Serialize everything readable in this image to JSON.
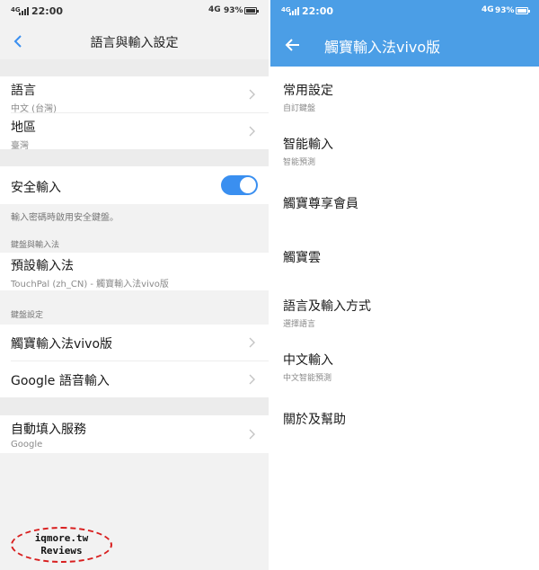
{
  "status_left": {
    "network": "4G",
    "time": "22:00",
    "network2": "4G",
    "battery": "93%",
    "battery_level": 0.93
  },
  "status_right": {
    "network": "4G",
    "time": "22:00",
    "network2": "4G",
    "battery": "93%",
    "battery_level": 0.93
  },
  "left": {
    "title": "語言與輸入設定",
    "language": {
      "label": "語言",
      "value": "中文 (台灣)"
    },
    "region": {
      "label": "地區",
      "value": "臺灣"
    },
    "secure_input": {
      "label": "安全輸入",
      "enabled": true,
      "note": "輸入密碼時啟用安全鍵盤。"
    },
    "section_keyboard_input": "鍵盤與輸入法",
    "default_ime": {
      "label": "預設輸入法",
      "value": "TouchPal (zh_CN) - 觸寶輸入法vivo版"
    },
    "section_keyboard_settings": "鍵盤設定",
    "keyboards": [
      {
        "label": "觸寶輸入法vivo版"
      },
      {
        "label": "Google 語音輸入"
      }
    ],
    "autofill": {
      "label": "自動填入服務",
      "value": "Google"
    }
  },
  "right": {
    "title": "觸寶輸入法vivo版",
    "items": [
      {
        "label": "常用設定",
        "sub": "自訂鍵盤"
      },
      {
        "label": "智能輸入",
        "sub": "智能預測"
      },
      {
        "label": "觸寶尊享會員",
        "sub": ""
      },
      {
        "label": "觸寶雲",
        "sub": ""
      },
      {
        "label": "語言及輸入方式",
        "sub": "選擇語言"
      },
      {
        "label": "中文輸入",
        "sub": "中文智能預測"
      },
      {
        "label": "關於及幫助",
        "sub": ""
      }
    ]
  },
  "watermark": {
    "line1": "iqmore.tw",
    "line2": "Reviews"
  },
  "colors": {
    "accent": "#4b9ee6",
    "toggle_on": "#3a8ff0",
    "watermark_ring": "#d81e1e"
  }
}
